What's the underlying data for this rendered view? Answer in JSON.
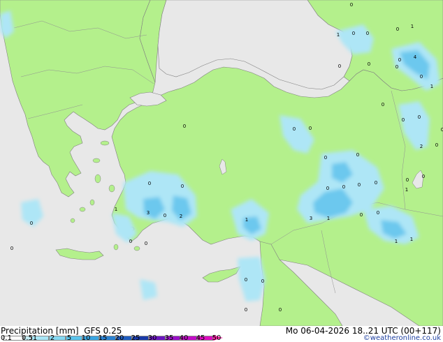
{
  "header": {
    "label": "Precipitation [mm]",
    "model": "GFS 0.25",
    "datetime": "Mo 06-04-2026 18..21 UTC (00+117)"
  },
  "legend": {
    "ticks": [
      "0.1",
      "0.5",
      "1",
      "2",
      "5",
      "10",
      "15",
      "20",
      "25",
      "30",
      "35",
      "40",
      "45",
      "50"
    ],
    "colors": [
      "#ffffff",
      "#c8f0f8",
      "#a8e6f6",
      "#84d8f2",
      "#5cc4ec",
      "#3aa6e2",
      "#2a82d2",
      "#1e5cc0",
      "#1a3aa8",
      "#6a16c0",
      "#9a10c8",
      "#c40ec8",
      "#e00cc0",
      "#f020a0"
    ]
  },
  "map": {
    "colors": {
      "sea": "#e8e8e8",
      "land": "#b4f08c",
      "light_rain": "#aee6f6",
      "moderate_rain": "#6cc8ee",
      "heavy_rain": "#3aa0e0"
    },
    "labels": [
      "0",
      "1",
      "0",
      "0",
      "0",
      "1",
      "4",
      "0",
      "0",
      "0",
      "1",
      "0",
      "0",
      "2",
      "0",
      "0",
      "0",
      "0",
      "0",
      "0",
      "0",
      "0",
      "0",
      "0",
      "0",
      "0",
      "1",
      "0",
      "0",
      "1",
      "3",
      "0",
      "2",
      "1",
      "3",
      "1",
      "0",
      "0",
      "0",
      "0",
      "1",
      "1",
      "0",
      "0",
      "0",
      "0",
      "0",
      "0",
      "0",
      "0",
      "0",
      "0",
      "0"
    ]
  },
  "footer": {
    "credit": "©weatheronline.co.uk"
  }
}
